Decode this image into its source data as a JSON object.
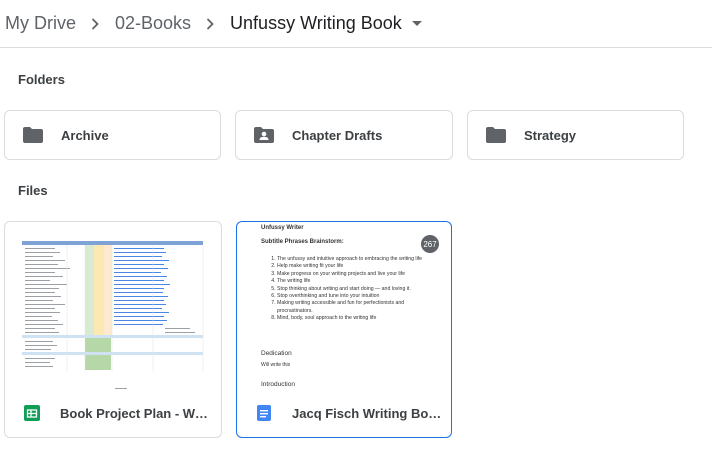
{
  "breadcrumb": {
    "items": [
      "My Drive",
      "02-Books",
      "Unfussy Writing Book"
    ]
  },
  "sections": {
    "folders_label": "Folders",
    "files_label": "Files"
  },
  "folders": [
    {
      "name": "Archive",
      "icon": "folder-icon"
    },
    {
      "name": "Chapter Drafts",
      "icon": "shared-folder-icon"
    },
    {
      "name": "Strategy",
      "icon": "folder-icon"
    }
  ],
  "files": [
    {
      "name": "Book Project Plan - Writ...",
      "type": "spreadsheet",
      "icon": "google-sheets-icon",
      "color": "#0f9d58"
    },
    {
      "name": "Jacq Fisch Writing Boo...",
      "type": "document",
      "icon": "google-docs-icon",
      "color": "#4285f4"
    }
  ],
  "doc_preview": {
    "title": "Unfussy Writer",
    "subtitle": "Subtitle Phrases Brainstorm:",
    "list": [
      "The unfussy and intuitive approach to embracing the writing life",
      "Help make writing fit your life",
      "Make progress on your writing projects and live your life",
      "The writing life",
      "Stop thinking about writing and start doing — and loving it.",
      "Stop overthinking and tune into your intuition",
      "Making writing accessible and fun for perfectionists and procrastinators.",
      "Mind, body, soul approach to the writing life"
    ],
    "dedication_heading": "Dedication",
    "dedication_text": "Will write this",
    "introduction_heading": "Introduction",
    "comment_count": "267"
  },
  "colors": {
    "accent": "#1a73e8",
    "border": "#dadce0",
    "text": "#3c4043"
  }
}
